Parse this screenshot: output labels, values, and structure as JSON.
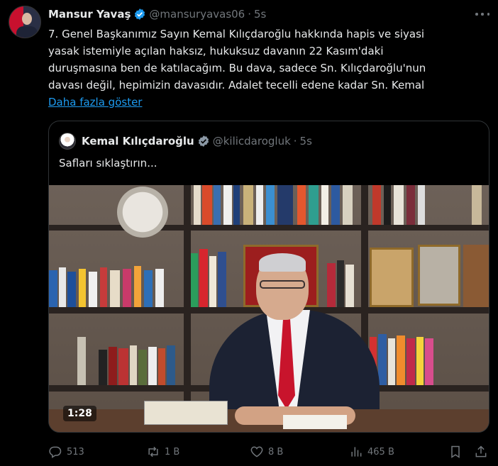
{
  "tweet": {
    "author_name": "Mansur Yavaş",
    "handle": "@mansuryavas06",
    "separator": "·",
    "time": "5s",
    "text_lines": [
      "7. Genel Başkanımız Sayın Kemal Kılıçdaroğlu hakkında hapis ve siyasi",
      "yasak istemiyle açılan haksız, hukuksuz davanın 22 Kasım'daki",
      "duruşmasına ben de katılacağım. Bu dava, sadece Sn. Kılıçdaroğlu'nun",
      "davası değil, hepimizin davasıdır. Adalet tecelli edene kadar Sn. Kemal"
    ],
    "show_more": "Daha fazla göster"
  },
  "quote": {
    "author_name": "Kemal Kılıçdaroğlu",
    "handle": "@kilicdarogluk",
    "separator": "·",
    "time": "5s",
    "text": "Safları sıklaştırın...",
    "video_duration": "1:28"
  },
  "actions": {
    "replies": "513",
    "reposts": "1 B",
    "likes": "8 B",
    "views": "465 B"
  },
  "colors": {
    "background": "#000000",
    "text": "#e7e9ea",
    "muted": "#71767b",
    "link": "#1d9bf0",
    "verified": "#1d9bf0",
    "border": "#2f3336"
  },
  "icons": [
    "verified-badge-icon",
    "more-icon",
    "reply-icon",
    "repost-icon",
    "like-icon",
    "views-icon",
    "bookmark-icon",
    "share-icon"
  ]
}
